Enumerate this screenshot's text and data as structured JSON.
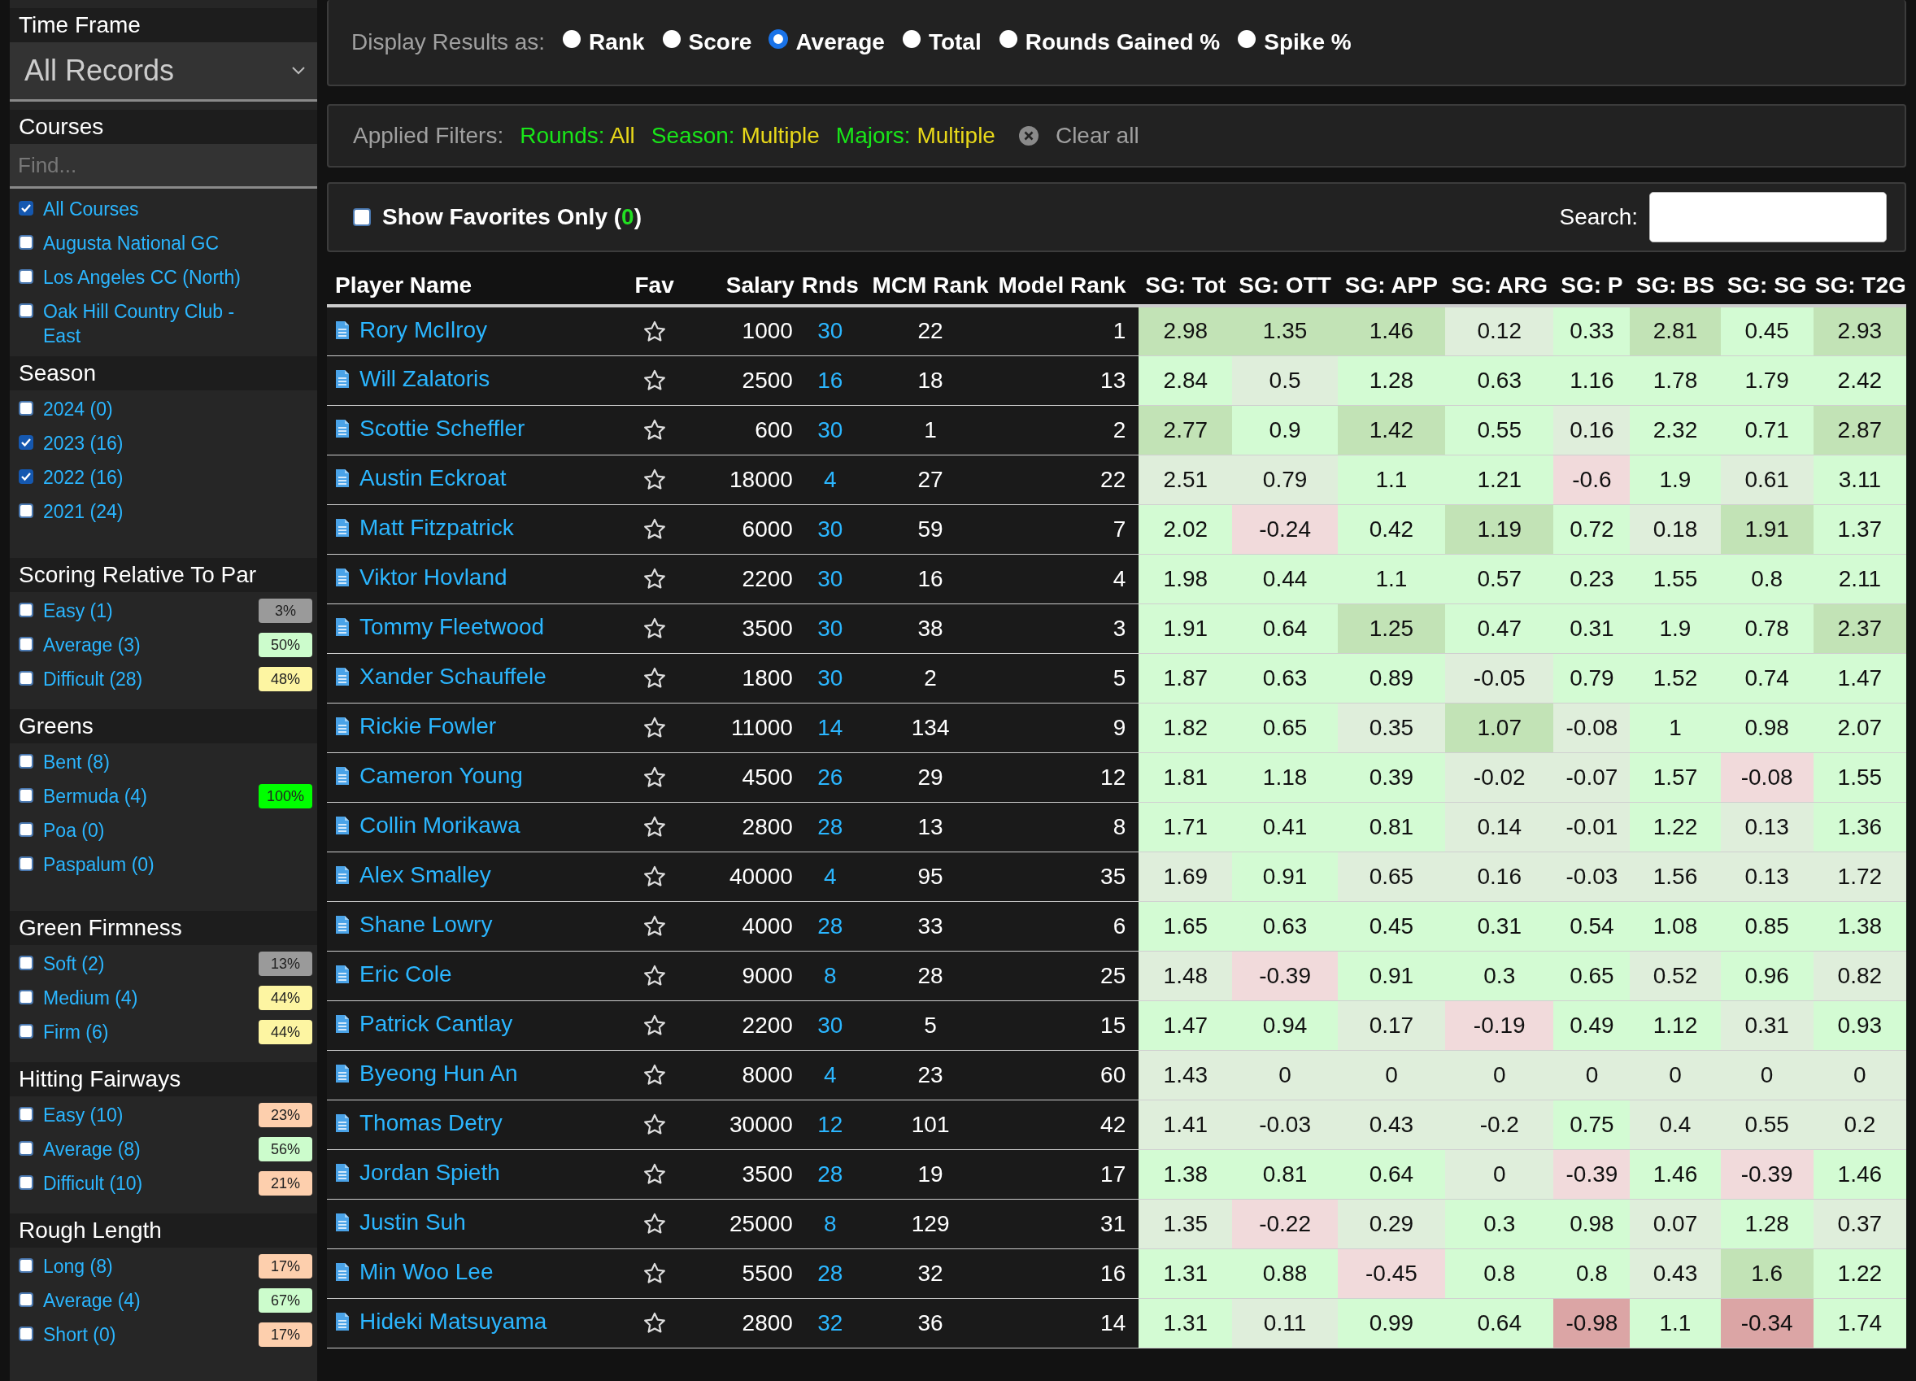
{
  "sidebar": {
    "sections": [
      {
        "kind": "select",
        "title": "Time Frame",
        "value": "All Records"
      },
      {
        "kind": "checklist",
        "title": "Courses",
        "search": {
          "placeholder": "Find..."
        },
        "items": [
          {
            "label": "All Courses",
            "checked": true
          },
          {
            "label": "Augusta National GC",
            "checked": false
          },
          {
            "label": "Los Angeles CC (North)",
            "checked": false
          },
          {
            "label": "Oak Hill Country Club - East",
            "checked": false
          }
        ]
      },
      {
        "kind": "scroll-list",
        "title": "Season",
        "items": [
          {
            "label": "2024 (0)",
            "checked": false
          },
          {
            "label": "2023 (16)",
            "checked": true
          },
          {
            "label": "2022 (16)",
            "checked": true
          },
          {
            "label": "2021 (24)",
            "checked": false
          }
        ]
      },
      {
        "kind": "checklist",
        "title": "Scoring Relative To Par",
        "items": [
          {
            "label": "Easy (1)",
            "checked": false,
            "badge": {
              "text": "3%",
              "color": "#9a9a9a"
            }
          },
          {
            "label": "Average (3)",
            "checked": false,
            "badge": {
              "text": "50%",
              "color": "#ccfccc"
            }
          },
          {
            "label": "Difficult (28)",
            "checked": false,
            "badge": {
              "text": "48%",
              "color": "#fdf5a2"
            }
          }
        ]
      },
      {
        "kind": "scroll-list",
        "title": "Greens",
        "items": [
          {
            "label": "Bent (8)",
            "checked": false
          },
          {
            "label": "Bermuda (4)",
            "checked": false,
            "badge": {
              "text": "100%",
              "color": "#00ff00"
            }
          },
          {
            "label": "Poa (0)",
            "checked": false
          },
          {
            "label": "Paspalum (0)",
            "checked": false
          }
        ]
      },
      {
        "kind": "checklist",
        "title": "Green Firmness",
        "items": [
          {
            "label": "Soft (2)",
            "checked": false,
            "badge": {
              "text": "13%",
              "color": "#9a9a9a"
            }
          },
          {
            "label": "Medium (4)",
            "checked": false,
            "badge": {
              "text": "44%",
              "color": "#fdf5a2"
            }
          },
          {
            "label": "Firm (6)",
            "checked": false,
            "badge": {
              "text": "44%",
              "color": "#fdf5a2"
            }
          }
        ]
      },
      {
        "kind": "checklist",
        "title": "Hitting Fairways",
        "items": [
          {
            "label": "Easy (10)",
            "checked": false,
            "badge": {
              "text": "23%",
              "color": "#fdcfad"
            }
          },
          {
            "label": "Average (8)",
            "checked": false,
            "badge": {
              "text": "56%",
              "color": "#ccfccc"
            }
          },
          {
            "label": "Difficult (10)",
            "checked": false,
            "badge": {
              "text": "21%",
              "color": "#fdcfad"
            }
          }
        ]
      },
      {
        "kind": "checklist",
        "title": "Rough Length",
        "items": [
          {
            "label": "Long (8)",
            "checked": false,
            "badge": {
              "text": "17%",
              "color": "#fdcfad"
            }
          },
          {
            "label": "Average (4)",
            "checked": false,
            "badge": {
              "text": "67%",
              "color": "#ccfccc"
            }
          },
          {
            "label": "Short (0)",
            "checked": false,
            "badge": {
              "text": "17%",
              "color": "#fdcfad"
            }
          }
        ]
      }
    ]
  },
  "display": {
    "label": "Display Results as:",
    "options": [
      {
        "label": "Rank",
        "selected": false
      },
      {
        "label": "Score",
        "selected": false
      },
      {
        "label": "Average",
        "selected": true
      },
      {
        "label": "Total",
        "selected": false
      },
      {
        "label": "Rounds Gained %",
        "selected": false
      },
      {
        "label": "Spike %",
        "selected": false
      }
    ]
  },
  "filters": {
    "label": "Applied Filters:",
    "items": [
      {
        "key": "Rounds:",
        "value": "All"
      },
      {
        "key": "Season:",
        "value": "Multiple"
      },
      {
        "key": "Majors:",
        "value": "Multiple"
      }
    ],
    "clear": "Clear all"
  },
  "favorites": {
    "label": "Show Favorites Only (",
    "count": "0",
    "suffix": ")",
    "checked": false
  },
  "search": {
    "label": "Search:"
  },
  "table": {
    "columns": [
      "Player Name",
      "Fav",
      "Salary",
      "Rnds",
      "MCM Rank",
      "Model Rank",
      "SG: Tot",
      "SG: OTT",
      "SG: APP",
      "SG: ARG",
      "SG: P",
      "SG: BS",
      "SG: SG",
      "SG: T2G"
    ],
    "rows": [
      {
        "name": "Rory McIlroy",
        "salary": "1000",
        "rnds": "30",
        "mcm": "22",
        "model": "1",
        "sg": [
          {
            "value": "2.98",
            "color": "#c2e3b6"
          },
          {
            "value": "1.35",
            "color": "#c2e3b6"
          },
          {
            "value": "1.46",
            "color": "#c2e3b6"
          },
          {
            "value": "0.12",
            "color": "#dfeedb"
          },
          {
            "value": "0.33",
            "color": "#d3fbd3"
          },
          {
            "value": "2.81",
            "color": "#c2e3b6"
          },
          {
            "value": "0.45",
            "color": "#d3fbd3"
          },
          {
            "value": "2.93",
            "color": "#c2e3b6"
          }
        ]
      },
      {
        "name": "Will Zalatoris",
        "salary": "2500",
        "rnds": "16",
        "mcm": "18",
        "model": "13",
        "sg": [
          {
            "value": "2.84",
            "color": "#d3fbd3"
          },
          {
            "value": "0.5",
            "color": "#dfeedb"
          },
          {
            "value": "1.28",
            "color": "#d3fbd3"
          },
          {
            "value": "0.63",
            "color": "#d3fbd3"
          },
          {
            "value": "1.16",
            "color": "#d3fbd3"
          },
          {
            "value": "1.78",
            "color": "#d3fbd3"
          },
          {
            "value": "1.79",
            "color": "#d3fbd3"
          },
          {
            "value": "2.42",
            "color": "#d3fbd3"
          }
        ]
      },
      {
        "name": "Scottie Scheffler",
        "salary": "600",
        "rnds": "30",
        "mcm": "1",
        "model": "2",
        "sg": [
          {
            "value": "2.77",
            "color": "#c2e3b6"
          },
          {
            "value": "0.9",
            "color": "#d3fbd3"
          },
          {
            "value": "1.42",
            "color": "#c2e3b6"
          },
          {
            "value": "0.55",
            "color": "#d3fbd3"
          },
          {
            "value": "0.16",
            "color": "#dfeedb"
          },
          {
            "value": "2.32",
            "color": "#d3fbd3"
          },
          {
            "value": "0.71",
            "color": "#d3fbd3"
          },
          {
            "value": "2.87",
            "color": "#c2e3b6"
          }
        ]
      },
      {
        "name": "Austin Eckroat",
        "salary": "18000",
        "rnds": "4",
        "mcm": "27",
        "model": "22",
        "sg": [
          {
            "value": "2.51",
            "color": "#dfeedb"
          },
          {
            "value": "0.79",
            "color": "#dfeedb"
          },
          {
            "value": "1.1",
            "color": "#d3fbd3"
          },
          {
            "value": "1.21",
            "color": "#d3fbd3"
          },
          {
            "value": "-0.6",
            "color": "#f1dadb"
          },
          {
            "value": "1.9",
            "color": "#d3fbd3"
          },
          {
            "value": "0.61",
            "color": "#dfeedb"
          },
          {
            "value": "3.11",
            "color": "#d3fbd3"
          }
        ]
      },
      {
        "name": "Matt Fitzpatrick",
        "salary": "6000",
        "rnds": "30",
        "mcm": "59",
        "model": "7",
        "sg": [
          {
            "value": "2.02",
            "color": "#d3fbd3"
          },
          {
            "value": "-0.24",
            "color": "#f1dadb"
          },
          {
            "value": "0.42",
            "color": "#d3fbd3"
          },
          {
            "value": "1.19",
            "color": "#c2e3b6"
          },
          {
            "value": "0.72",
            "color": "#d3fbd3"
          },
          {
            "value": "0.18",
            "color": "#dfeedb"
          },
          {
            "value": "1.91",
            "color": "#c2e3b6"
          },
          {
            "value": "1.37",
            "color": "#d3fbd3"
          }
        ]
      },
      {
        "name": "Viktor Hovland",
        "salary": "2200",
        "rnds": "30",
        "mcm": "16",
        "model": "4",
        "sg": [
          {
            "value": "1.98",
            "color": "#d3fbd3"
          },
          {
            "value": "0.44",
            "color": "#d3fbd3"
          },
          {
            "value": "1.1",
            "color": "#d3fbd3"
          },
          {
            "value": "0.57",
            "color": "#d3fbd3"
          },
          {
            "value": "0.23",
            "color": "#d3fbd3"
          },
          {
            "value": "1.55",
            "color": "#d3fbd3"
          },
          {
            "value": "0.8",
            "color": "#d3fbd3"
          },
          {
            "value": "2.11",
            "color": "#d3fbd3"
          }
        ]
      },
      {
        "name": "Tommy Fleetwood",
        "salary": "3500",
        "rnds": "30",
        "mcm": "38",
        "model": "3",
        "sg": [
          {
            "value": "1.91",
            "color": "#d3fbd3"
          },
          {
            "value": "0.64",
            "color": "#d3fbd3"
          },
          {
            "value": "1.25",
            "color": "#c2e3b6"
          },
          {
            "value": "0.47",
            "color": "#d3fbd3"
          },
          {
            "value": "0.31",
            "color": "#d3fbd3"
          },
          {
            "value": "1.9",
            "color": "#d3fbd3"
          },
          {
            "value": "0.78",
            "color": "#d3fbd3"
          },
          {
            "value": "2.37",
            "color": "#c2e3b6"
          }
        ]
      },
      {
        "name": "Xander Schauffele",
        "salary": "1800",
        "rnds": "30",
        "mcm": "2",
        "model": "5",
        "sg": [
          {
            "value": "1.87",
            "color": "#d3fbd3"
          },
          {
            "value": "0.63",
            "color": "#d3fbd3"
          },
          {
            "value": "0.89",
            "color": "#d3fbd3"
          },
          {
            "value": "-0.05",
            "color": "#dfeedb"
          },
          {
            "value": "0.79",
            "color": "#d3fbd3"
          },
          {
            "value": "1.52",
            "color": "#d3fbd3"
          },
          {
            "value": "0.74",
            "color": "#d3fbd3"
          },
          {
            "value": "1.47",
            "color": "#d3fbd3"
          }
        ]
      },
      {
        "name": "Rickie Fowler",
        "salary": "11000",
        "rnds": "14",
        "mcm": "134",
        "model": "9",
        "sg": [
          {
            "value": "1.82",
            "color": "#d3fbd3"
          },
          {
            "value": "0.65",
            "color": "#d3fbd3"
          },
          {
            "value": "0.35",
            "color": "#dfeedb"
          },
          {
            "value": "1.07",
            "color": "#c2e3b6"
          },
          {
            "value": "-0.08",
            "color": "#dfeedb"
          },
          {
            "value": "1",
            "color": "#d3fbd3"
          },
          {
            "value": "0.98",
            "color": "#d3fbd3"
          },
          {
            "value": "2.07",
            "color": "#d3fbd3"
          }
        ]
      },
      {
        "name": "Cameron Young",
        "salary": "4500",
        "rnds": "26",
        "mcm": "29",
        "model": "12",
        "sg": [
          {
            "value": "1.81",
            "color": "#d3fbd3"
          },
          {
            "value": "1.18",
            "color": "#d3fbd3"
          },
          {
            "value": "0.39",
            "color": "#d3fbd3"
          },
          {
            "value": "-0.02",
            "color": "#dfeedb"
          },
          {
            "value": "-0.07",
            "color": "#dfeedb"
          },
          {
            "value": "1.57",
            "color": "#d3fbd3"
          },
          {
            "value": "-0.08",
            "color": "#f1dadb"
          },
          {
            "value": "1.55",
            "color": "#d3fbd3"
          }
        ]
      },
      {
        "name": "Collin Morikawa",
        "salary": "2800",
        "rnds": "28",
        "mcm": "13",
        "model": "8",
        "sg": [
          {
            "value": "1.71",
            "color": "#d3fbd3"
          },
          {
            "value": "0.41",
            "color": "#d3fbd3"
          },
          {
            "value": "0.81",
            "color": "#d3fbd3"
          },
          {
            "value": "0.14",
            "color": "#dfeedb"
          },
          {
            "value": "-0.01",
            "color": "#dfeedb"
          },
          {
            "value": "1.22",
            "color": "#d3fbd3"
          },
          {
            "value": "0.13",
            "color": "#dfeedb"
          },
          {
            "value": "1.36",
            "color": "#d3fbd3"
          }
        ]
      },
      {
        "name": "Alex Smalley",
        "salary": "40000",
        "rnds": "4",
        "mcm": "95",
        "model": "35",
        "sg": [
          {
            "value": "1.69",
            "color": "#dfeedb"
          },
          {
            "value": "0.91",
            "color": "#d3fbd3"
          },
          {
            "value": "0.65",
            "color": "#dfeedb"
          },
          {
            "value": "0.16",
            "color": "#dfeedb"
          },
          {
            "value": "-0.03",
            "color": "#dfeedb"
          },
          {
            "value": "1.56",
            "color": "#dfeedb"
          },
          {
            "value": "0.13",
            "color": "#dfeedb"
          },
          {
            "value": "1.72",
            "color": "#dfeedb"
          }
        ]
      },
      {
        "name": "Shane Lowry",
        "salary": "4000",
        "rnds": "28",
        "mcm": "33",
        "model": "6",
        "sg": [
          {
            "value": "1.65",
            "color": "#d3fbd3"
          },
          {
            "value": "0.63",
            "color": "#d3fbd3"
          },
          {
            "value": "0.45",
            "color": "#d3fbd3"
          },
          {
            "value": "0.31",
            "color": "#d3fbd3"
          },
          {
            "value": "0.54",
            "color": "#d3fbd3"
          },
          {
            "value": "1.08",
            "color": "#d3fbd3"
          },
          {
            "value": "0.85",
            "color": "#d3fbd3"
          },
          {
            "value": "1.38",
            "color": "#d3fbd3"
          }
        ]
      },
      {
        "name": "Eric Cole",
        "salary": "9000",
        "rnds": "8",
        "mcm": "28",
        "model": "25",
        "sg": [
          {
            "value": "1.48",
            "color": "#dfeedb"
          },
          {
            "value": "-0.39",
            "color": "#f1dadb"
          },
          {
            "value": "0.91",
            "color": "#d3fbd3"
          },
          {
            "value": "0.3",
            "color": "#d3fbd3"
          },
          {
            "value": "0.65",
            "color": "#d3fbd3"
          },
          {
            "value": "0.52",
            "color": "#dfeedb"
          },
          {
            "value": "0.96",
            "color": "#d3fbd3"
          },
          {
            "value": "0.82",
            "color": "#dfeedb"
          }
        ]
      },
      {
        "name": "Patrick Cantlay",
        "salary": "2200",
        "rnds": "30",
        "mcm": "5",
        "model": "15",
        "sg": [
          {
            "value": "1.47",
            "color": "#d3fbd3"
          },
          {
            "value": "0.94",
            "color": "#d3fbd3"
          },
          {
            "value": "0.17",
            "color": "#dfeedb"
          },
          {
            "value": "-0.19",
            "color": "#f1dadb"
          },
          {
            "value": "0.49",
            "color": "#d3fbd3"
          },
          {
            "value": "1.12",
            "color": "#d3fbd3"
          },
          {
            "value": "0.31",
            "color": "#dfeedb"
          },
          {
            "value": "0.93",
            "color": "#d3fbd3"
          }
        ]
      },
      {
        "name": "Byeong Hun An",
        "salary": "8000",
        "rnds": "4",
        "mcm": "23",
        "model": "60",
        "sg": [
          {
            "value": "1.43",
            "color": "#dfeedb"
          },
          {
            "value": "0",
            "color": "#dfeedb"
          },
          {
            "value": "0",
            "color": "#dfeedb"
          },
          {
            "value": "0",
            "color": "#dfeedb"
          },
          {
            "value": "0",
            "color": "#dfeedb"
          },
          {
            "value": "0",
            "color": "#dfeedb"
          },
          {
            "value": "0",
            "color": "#dfeedb"
          },
          {
            "value": "0",
            "color": "#dfeedb"
          }
        ]
      },
      {
        "name": "Thomas Detry",
        "salary": "30000",
        "rnds": "12",
        "mcm": "101",
        "model": "42",
        "sg": [
          {
            "value": "1.41",
            "color": "#dfeedb"
          },
          {
            "value": "-0.03",
            "color": "#dfeedb"
          },
          {
            "value": "0.43",
            "color": "#dfeedb"
          },
          {
            "value": "-0.2",
            "color": "#dfeedb"
          },
          {
            "value": "0.75",
            "color": "#d3fbd3"
          },
          {
            "value": "0.4",
            "color": "#dfeedb"
          },
          {
            "value": "0.55",
            "color": "#dfeedb"
          },
          {
            "value": "0.2",
            "color": "#dfeedb"
          }
        ]
      },
      {
        "name": "Jordan Spieth",
        "salary": "3500",
        "rnds": "28",
        "mcm": "19",
        "model": "17",
        "sg": [
          {
            "value": "1.38",
            "color": "#d3fbd3"
          },
          {
            "value": "0.81",
            "color": "#d3fbd3"
          },
          {
            "value": "0.64",
            "color": "#d3fbd3"
          },
          {
            "value": "0",
            "color": "#dfeedb"
          },
          {
            "value": "-0.39",
            "color": "#f1dadb"
          },
          {
            "value": "1.46",
            "color": "#d3fbd3"
          },
          {
            "value": "-0.39",
            "color": "#f1dadb"
          },
          {
            "value": "1.46",
            "color": "#d3fbd3"
          }
        ]
      },
      {
        "name": "Justin Suh",
        "salary": "25000",
        "rnds": "8",
        "mcm": "129",
        "model": "31",
        "sg": [
          {
            "value": "1.35",
            "color": "#dfeedb"
          },
          {
            "value": "-0.22",
            "color": "#f1dadb"
          },
          {
            "value": "0.29",
            "color": "#dfeedb"
          },
          {
            "value": "0.3",
            "color": "#d3fbd3"
          },
          {
            "value": "0.98",
            "color": "#d3fbd3"
          },
          {
            "value": "0.07",
            "color": "#dfeedb"
          },
          {
            "value": "1.28",
            "color": "#d3fbd3"
          },
          {
            "value": "0.37",
            "color": "#dfeedb"
          }
        ]
      },
      {
        "name": "Min Woo Lee",
        "salary": "5500",
        "rnds": "28",
        "mcm": "32",
        "model": "16",
        "sg": [
          {
            "value": "1.31",
            "color": "#d3fbd3"
          },
          {
            "value": "0.88",
            "color": "#d3fbd3"
          },
          {
            "value": "-0.45",
            "color": "#f1dadb"
          },
          {
            "value": "0.8",
            "color": "#d3fbd3"
          },
          {
            "value": "0.8",
            "color": "#d3fbd3"
          },
          {
            "value": "0.43",
            "color": "#dfeedb"
          },
          {
            "value": "1.6",
            "color": "#c2e3b6"
          },
          {
            "value": "1.22",
            "color": "#d3fbd3"
          }
        ]
      },
      {
        "name": "Hideki Matsuyama",
        "salary": "2800",
        "rnds": "32",
        "mcm": "36",
        "model": "14",
        "sg": [
          {
            "value": "1.31",
            "color": "#d3fbd3"
          },
          {
            "value": "0.11",
            "color": "#dfeedb"
          },
          {
            "value": "0.99",
            "color": "#d3fbd3"
          },
          {
            "value": "0.64",
            "color": "#d3fbd3"
          },
          {
            "value": "-0.98",
            "color": "#dba5a5"
          },
          {
            "value": "1.1",
            "color": "#d3fbd3"
          },
          {
            "value": "-0.34",
            "color": "#dba5a5"
          },
          {
            "value": "1.74",
            "color": "#d3fbd3"
          }
        ]
      }
    ]
  }
}
